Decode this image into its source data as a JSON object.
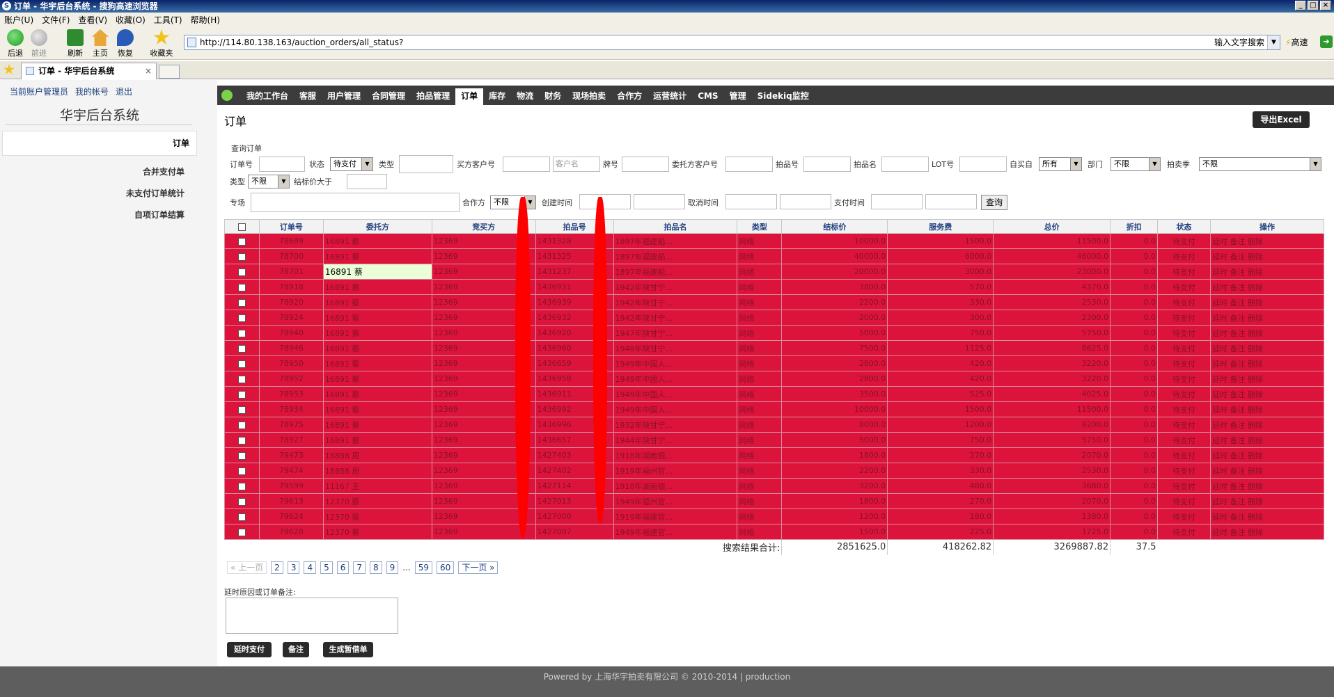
{
  "window": {
    "title": "订单 - 华宇后台系统 - 搜狗高速浏览器",
    "controls": [
      "_",
      "□",
      "×"
    ]
  },
  "menubar": [
    "账户(U)",
    "文件(F)",
    "查看(V)",
    "收藏(O)",
    "工具(T)",
    "帮助(H)"
  ],
  "toolbar": {
    "back": "后退",
    "forward": "前进",
    "refresh": "刷新",
    "home": "主页",
    "restore": "恢复",
    "favorites": "收藏夹"
  },
  "address": {
    "url": "http://114.80.138.163/auction_orders/all_status?",
    "search_hint": "输入文字搜索",
    "speed": "高速"
  },
  "browser_tab": {
    "label": "订单 - 华宇后台系统",
    "close": "×"
  },
  "top_links": [
    "当前账户管理员",
    "我的帐号",
    "退出"
  ],
  "system_title": "华宇后台系统",
  "sidebar": {
    "active": "订单",
    "items": [
      "合并支付单",
      "未支付订单统计",
      "自项订单结算"
    ]
  },
  "nav": {
    "items": [
      "我的工作台",
      "客服",
      "用户管理",
      "合同管理",
      "拍品管理",
      "订单",
      "库存",
      "物流",
      "财务",
      "现场拍卖",
      "合作方",
      "运营统计",
      "CMS",
      "管理",
      "Sidekiq监控"
    ],
    "active": "订单"
  },
  "page_title": "订单",
  "export_label": "导出Excel",
  "query": {
    "section": "查询订单",
    "order_no": "订单号",
    "status": "状态",
    "status_value": "待支付",
    "type": "类型",
    "buyer_id": "买方客户号",
    "buyer_name_ph": "客户名",
    "paddle": "牌号",
    "consignor_id": "委托方客户号",
    "lot_no": "拍品号",
    "lot_name": "拍品名",
    "lot": "LOT号",
    "self_buy": "自买自",
    "self_buy_value": "所有",
    "dept": "部门",
    "dept_value": "不限",
    "season": "拍卖季",
    "season_value": "不限",
    "type2": "类型",
    "type2_value": "不限",
    "hammer_gt": "结标价大于",
    "special": "专场",
    "partner": "合作方",
    "partner_value": "不限",
    "created": "创建时间",
    "cancelled": "取消时间",
    "paid": "支付时间",
    "search_btn": "查询"
  },
  "table": {
    "headers": [
      "订单号",
      "委托方",
      "竞买方",
      "拍品号",
      "拍品名",
      "类型",
      "结标价",
      "服务费",
      "总价",
      "折扣",
      "状态",
      "操作"
    ],
    "rows": [
      {
        "id": "78689",
        "consignor": "16891 蔡",
        "buyer": "12369",
        "lot": "1431328",
        "name": "1897年福建船...",
        "type": "网络",
        "hammer": "10000.0",
        "fee": "1500.0",
        "total": "11500.0",
        "disc": "0.0",
        "status": "待支付",
        "ops": "延时 备注 删除"
      },
      {
        "id": "78700",
        "consignor": "16891 蔡",
        "buyer": "12369",
        "lot": "1431325",
        "name": "1897年福建船...",
        "type": "网络",
        "hammer": "40000.0",
        "fee": "6000.0",
        "total": "46000.0",
        "disc": "0.0",
        "status": "待支付",
        "ops": "延时 备注 删除"
      },
      {
        "id": "78701",
        "consignor": "16891 蔡",
        "buyer": "12369",
        "lot": "1431237",
        "name": "1897年福建船...",
        "type": "网络",
        "hammer": "20000.0",
        "fee": "3000.0",
        "total": "23000.0",
        "disc": "0.0",
        "status": "待支付",
        "ops": "延时 备注 删除",
        "highlight": true
      },
      {
        "id": "78918",
        "consignor": "16891 蔡",
        "buyer": "12369",
        "lot": "1436931",
        "name": "1942年陕甘宁...",
        "type": "网络",
        "hammer": "3800.0",
        "fee": "570.0",
        "total": "4370.0",
        "disc": "0.0",
        "status": "待支付",
        "ops": "延时 备注 删除"
      },
      {
        "id": "78920",
        "consignor": "16891 蔡",
        "buyer": "12369",
        "lot": "1436939",
        "name": "1942年陕甘宁...",
        "type": "网络",
        "hammer": "2200.0",
        "fee": "330.0",
        "total": "2530.0",
        "disc": "0.0",
        "status": "待支付",
        "ops": "延时 备注 删除"
      },
      {
        "id": "78924",
        "consignor": "16891 蔡",
        "buyer": "12369",
        "lot": "1436932",
        "name": "1942年陕甘宁...",
        "type": "网络",
        "hammer": "2000.0",
        "fee": "300.0",
        "total": "2300.0",
        "disc": "0.0",
        "status": "待支付",
        "ops": "延时 备注 删除"
      },
      {
        "id": "78940",
        "consignor": "16891 蔡",
        "buyer": "12369",
        "lot": "1436920",
        "name": "1947年陕甘宁...",
        "type": "网络",
        "hammer": "5000.0",
        "fee": "750.0",
        "total": "5750.0",
        "disc": "0.0",
        "status": "待支付",
        "ops": "延时 备注 删除"
      },
      {
        "id": "78946",
        "consignor": "16891 蔡",
        "buyer": "12369",
        "lot": "1436960",
        "name": "1948年陕甘宁...",
        "type": "网络",
        "hammer": "7500.0",
        "fee": "1125.0",
        "total": "8625.0",
        "disc": "0.0",
        "status": "待支付",
        "ops": "延时 备注 删除"
      },
      {
        "id": "78950",
        "consignor": "16891 蔡",
        "buyer": "12369",
        "lot": "1436659",
        "name": "1949年中国人...",
        "type": "网络",
        "hammer": "2800.0",
        "fee": "420.0",
        "total": "3220.0",
        "disc": "0.0",
        "status": "待支付",
        "ops": "延时 备注 删除"
      },
      {
        "id": "78952",
        "consignor": "16891 蔡",
        "buyer": "12369",
        "lot": "1436958",
        "name": "1949年中国人...",
        "type": "网络",
        "hammer": "2800.0",
        "fee": "420.0",
        "total": "3220.0",
        "disc": "0.0",
        "status": "待支付",
        "ops": "延时 备注 删除"
      },
      {
        "id": "78953",
        "consignor": "16891 蔡",
        "buyer": "12369",
        "lot": "1436911",
        "name": "1949年中国人...",
        "type": "网络",
        "hammer": "3500.0",
        "fee": "525.0",
        "total": "4025.0",
        "disc": "0.0",
        "status": "待支付",
        "ops": "延时 备注 删除"
      },
      {
        "id": "78934",
        "consignor": "16891 蔡",
        "buyer": "12369",
        "lot": "1436992",
        "name": "1949年中国人...",
        "type": "网络",
        "hammer": "10000.0",
        "fee": "1500.0",
        "total": "11500.0",
        "disc": "0.0",
        "status": "待支付",
        "ops": "延时 备注 删除"
      },
      {
        "id": "78975",
        "consignor": "16891 蔡",
        "buyer": "12369",
        "lot": "1436996",
        "name": "1932年陕甘宁...",
        "type": "网络",
        "hammer": "8000.0",
        "fee": "1200.0",
        "total": "9200.0",
        "disc": "0.0",
        "status": "待支付",
        "ops": "延时 备注 删除"
      },
      {
        "id": "78927",
        "consignor": "16891 蔡",
        "buyer": "12369",
        "lot": "1436657",
        "name": "1944年陕甘宁...",
        "type": "网络",
        "hammer": "5000.0",
        "fee": "750.0",
        "total": "5750.0",
        "disc": "0.0",
        "status": "待支付",
        "ops": "延时 备注 删除"
      },
      {
        "id": "79473",
        "consignor": "18888 周",
        "buyer": "12369",
        "lot": "1427403",
        "name": "1918年湖南银...",
        "type": "网络",
        "hammer": "1800.0",
        "fee": "270.0",
        "total": "2070.0",
        "disc": "0.0",
        "status": "待支付",
        "ops": "延时 备注 删除"
      },
      {
        "id": "79474",
        "consignor": "18888 周",
        "buyer": "12369",
        "lot": "1427402",
        "name": "1919年福州官...",
        "type": "网络",
        "hammer": "2200.0",
        "fee": "330.0",
        "total": "2530.0",
        "disc": "0.0",
        "status": "待支付",
        "ops": "延时 备注 删除"
      },
      {
        "id": "79599",
        "consignor": "11167 王",
        "buyer": "12369",
        "lot": "1427114",
        "name": "1918年湖南银...",
        "type": "网络",
        "hammer": "3200.0",
        "fee": "480.0",
        "total": "3680.0",
        "disc": "0.0",
        "status": "待支付",
        "ops": "延时 备注 删除"
      },
      {
        "id": "79613",
        "consignor": "12370 蔡",
        "buyer": "12369",
        "lot": "1427013",
        "name": "1949年福州官...",
        "type": "网络",
        "hammer": "1800.0",
        "fee": "270.0",
        "total": "2070.0",
        "disc": "0.0",
        "status": "待支付",
        "ops": "延时 备注 删除"
      },
      {
        "id": "79624",
        "consignor": "12370 蔡",
        "buyer": "12369",
        "lot": "1427000",
        "name": "1919年福建官...",
        "type": "网络",
        "hammer": "1200.0",
        "fee": "180.0",
        "total": "1380.0",
        "disc": "0.0",
        "status": "待支付",
        "ops": "延时 备注 删除"
      },
      {
        "id": "79628",
        "consignor": "12370 蔡",
        "buyer": "12369",
        "lot": "1427007",
        "name": "1949年福建官...",
        "type": "网络",
        "hammer": "1500.0",
        "fee": "225.0",
        "total": "1725.0",
        "disc": "0.0",
        "status": "待支付",
        "ops": "延时 备注 删除"
      }
    ],
    "summary": {
      "label": "搜索结果合计:",
      "hammer": "2851625.0",
      "fee": "418262.82",
      "total": "3269887.82",
      "disc": "37.5"
    }
  },
  "pager": {
    "prev": "« 上一页",
    "pages": [
      "2",
      "3",
      "4",
      "5",
      "6",
      "7",
      "8",
      "9"
    ],
    "dots": "...",
    "tail": [
      "59",
      "60"
    ],
    "next": "下一页 »"
  },
  "note_label": "延时原因或订单备注:",
  "actions": {
    "delay": "延时支付",
    "remark": "备注",
    "loan": "生成暂借单"
  },
  "footer": "Powered by 上海华宇拍卖有限公司 © 2010-2014 | production"
}
